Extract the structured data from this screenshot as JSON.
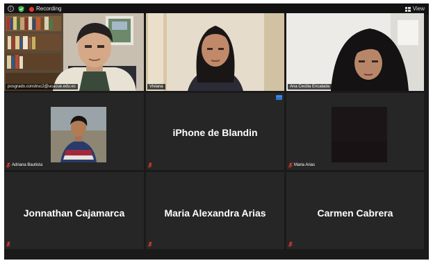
{
  "topbar": {
    "recording_label": "Recording",
    "view_label": "View"
  },
  "tiles": [
    {
      "name": "posgrado.construc2@ucacue.edu.ec",
      "type": "video",
      "active": true
    },
    {
      "name": "Viviana",
      "type": "video"
    },
    {
      "name": "Ana Cecilia Encalada",
      "type": "video"
    },
    {
      "name": "Adriana Bautista",
      "type": "photo",
      "muted": true
    },
    {
      "name": "iPhone de Blandin",
      "type": "name",
      "muted": true
    },
    {
      "name": "Maria Arias",
      "type": "photo",
      "muted": true
    },
    {
      "name": "Jonnathan Cajamarca",
      "type": "name",
      "muted": true
    },
    {
      "name": "Maria Alexandra Arias",
      "type": "name",
      "muted": true
    },
    {
      "name": "Carmen Cabrera",
      "type": "name",
      "muted": true
    }
  ],
  "colors": {
    "recording": "#e5392f",
    "active_speaker": "#c9e14a",
    "muted_mic": "#e5392f",
    "menu_button": "#2d78d8"
  },
  "icons": [
    "info-icon",
    "shield-icon",
    "recording-icon",
    "grid-view-icon",
    "mic-muted-icon",
    "more-options-icon"
  ]
}
